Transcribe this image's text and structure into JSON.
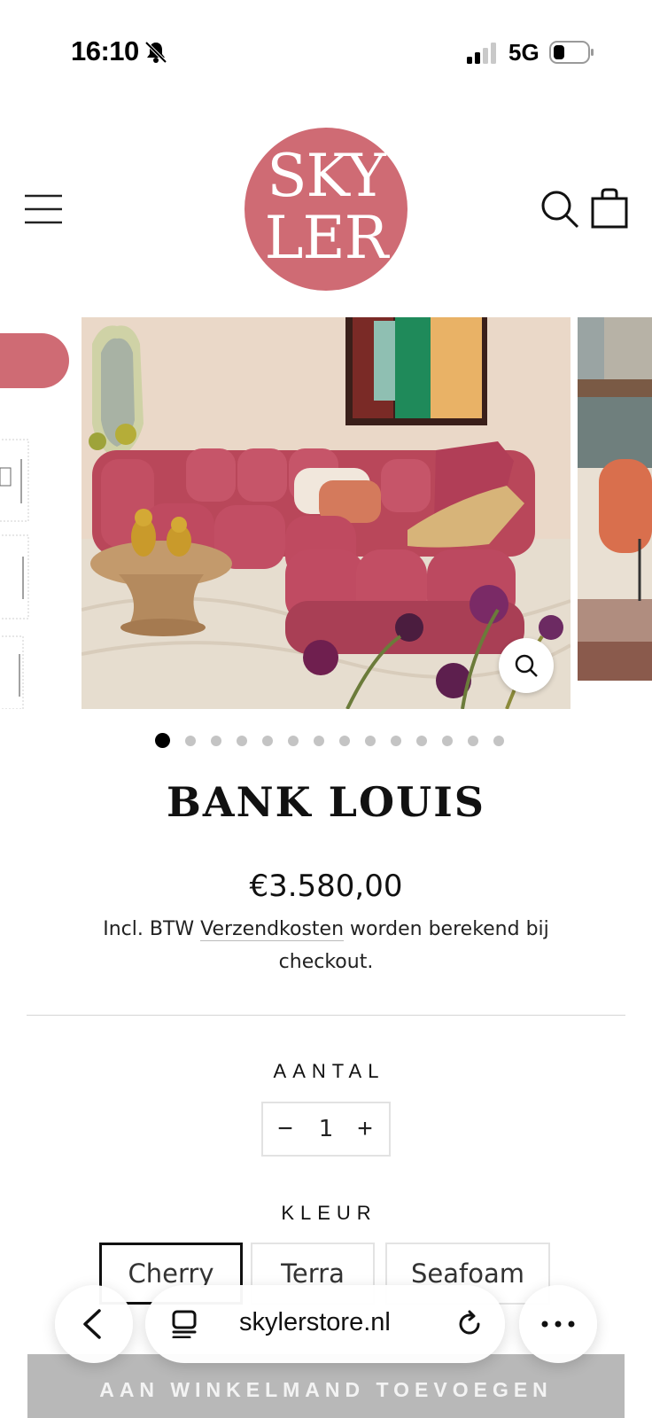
{
  "status_bar": {
    "time": "16:10",
    "network": "5G",
    "icons": [
      "bell-slash-icon",
      "signal-icon",
      "battery-icon"
    ]
  },
  "header": {
    "logo_line1": "SKY",
    "logo_line2": "LER",
    "logo_color": "#cf6b74",
    "icons": [
      "menu-icon",
      "search-icon",
      "bag-icon"
    ]
  },
  "gallery": {
    "slide_count": 14,
    "active_index": 0,
    "zoom_icon": "zoom-icon"
  },
  "product": {
    "title": "BANK LOUIS",
    "price": "€3.580,00",
    "tax_prefix": "Incl. BTW",
    "shipping_link": "Verzendkosten",
    "tax_suffix": "worden berekend bij checkout."
  },
  "quantity": {
    "label": "AANTAL",
    "minus": "−",
    "value": "1",
    "plus": "+"
  },
  "color": {
    "label": "KLEUR",
    "options": [
      "Cherry",
      "Terra",
      "Seafoam"
    ],
    "selected": "Cherry"
  },
  "cart": {
    "button_label": "AAN WINKELMAND TOEVOEGEN"
  },
  "browser": {
    "url": "skylerstore.nl",
    "icons": [
      "back-icon",
      "tabs-icon",
      "reload-icon",
      "more-icon"
    ]
  }
}
